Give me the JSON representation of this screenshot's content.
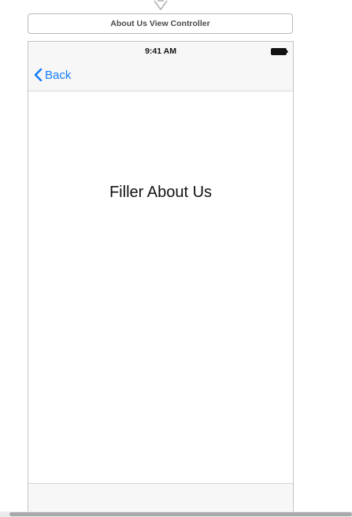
{
  "scene": {
    "title": "About Us View Controller",
    "entry_arrow_icon": "segue-arrow-icon"
  },
  "device": {
    "status_bar": {
      "time": "9:41 AM",
      "battery_icon": "battery-icon"
    },
    "nav_bar": {
      "back_label": "Back",
      "back_icon": "chevron-left-icon"
    },
    "content": {
      "label": "Filler About Us"
    }
  },
  "colors": {
    "tint": "#157efb",
    "bar_background": "#f7f7f7",
    "text": "#111111"
  }
}
